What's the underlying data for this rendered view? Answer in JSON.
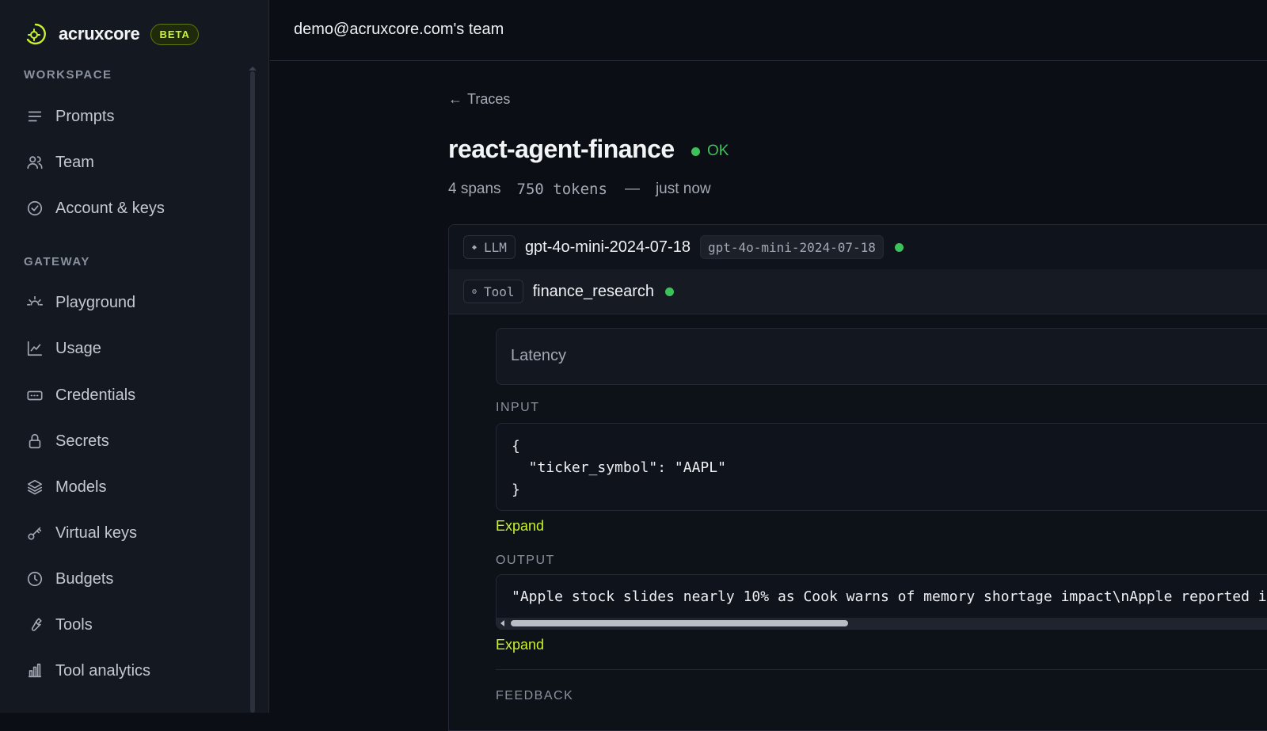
{
  "brand": {
    "name": "acruxcore",
    "badge": "BETA",
    "accent": "#c8f230"
  },
  "sidebar": {
    "workspace_title": "WORKSPACE",
    "workspace_items": [
      {
        "label": "Prompts",
        "icon": "list-icon"
      },
      {
        "label": "Team",
        "icon": "users-icon"
      },
      {
        "label": "Account & keys",
        "icon": "check-circle-icon"
      }
    ],
    "gateway_title": "GATEWAY",
    "gateway_items": [
      {
        "label": "Playground",
        "icon": "sun-icon"
      },
      {
        "label": "Usage",
        "icon": "line-chart-icon"
      },
      {
        "label": "Credentials",
        "icon": "card-icon"
      },
      {
        "label": "Secrets",
        "icon": "lock-icon"
      },
      {
        "label": "Models",
        "icon": "layers-icon"
      },
      {
        "label": "Virtual keys",
        "icon": "key-icon"
      },
      {
        "label": "Budgets",
        "icon": "clock-icon"
      },
      {
        "label": "Tools",
        "icon": "wrench-icon"
      },
      {
        "label": "Tool analytics",
        "icon": "bar-chart-icon"
      }
    ]
  },
  "header": {
    "team": "demo@acruxcore.com's team"
  },
  "trace": {
    "back_label": "Traces",
    "title": "react-agent-finance",
    "status": "OK",
    "status_color": "#3dc15a",
    "spans": "4 spans",
    "tokens": "750 tokens",
    "separator": "—",
    "time": "just now"
  },
  "spans": [
    {
      "kind": "LLM",
      "kind_icon": "diamond-icon",
      "name": "gpt-4o-mini-2024-07-18",
      "model": "gpt-4o-mini-2024-07-18",
      "status": "ok"
    },
    {
      "kind": "Tool",
      "kind_icon": "gear-icon",
      "name": "finance_research",
      "status": "ok"
    }
  ],
  "detail": {
    "latency_label": "Latency",
    "input_label": "INPUT",
    "input_lines": [
      "{",
      "  \"ticker_symbol\": \"AAPL\"",
      "}"
    ],
    "expand_label": "Expand",
    "output_label": "OUTPUT",
    "output_text": "\"Apple stock slides nearly 10% as Cook warns of memory shortage impact\\nApple reported i",
    "feedback_label": "FEEDBACK"
  }
}
